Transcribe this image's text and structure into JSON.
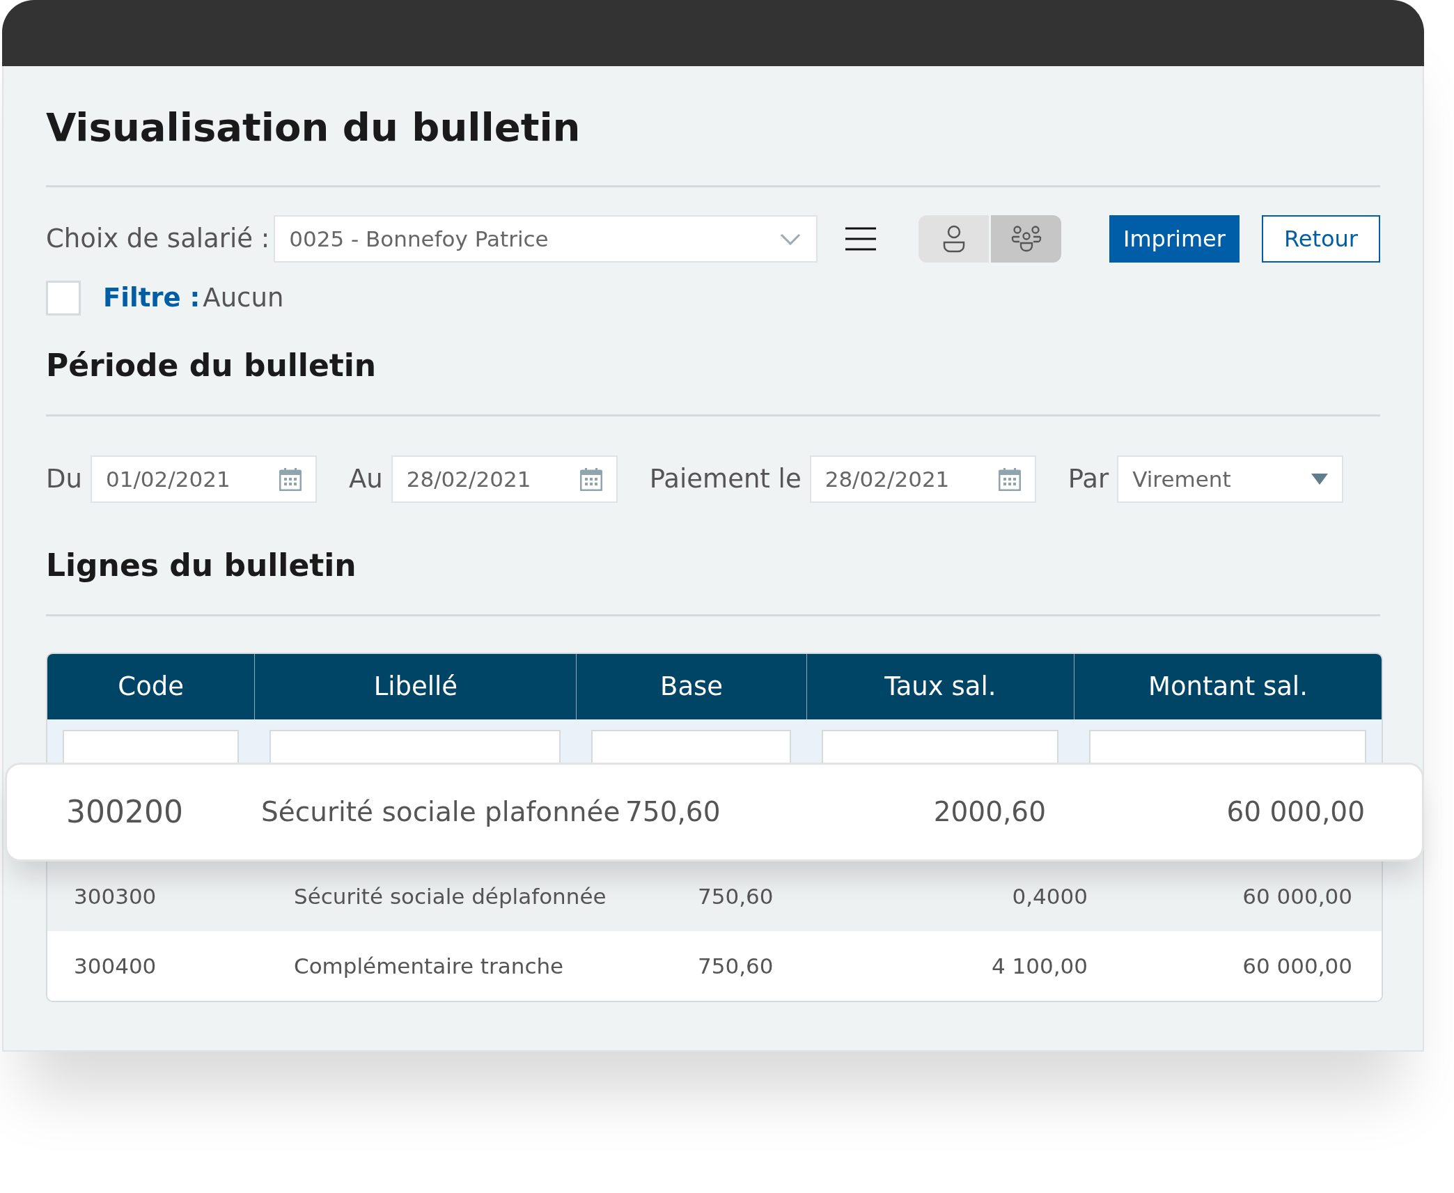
{
  "title": "Visualisation du bulletin",
  "employee_selector": {
    "label": "Choix de salarié :",
    "value": "0025 - Bonnefoy Patrice"
  },
  "view_toggle": [
    {
      "kind": "single",
      "selected": false
    },
    {
      "kind": "group",
      "selected": true
    }
  ],
  "buttons": [
    {
      "label": "Imprimer",
      "kind": "primary"
    },
    {
      "label": "Retour",
      "kind": "secondary"
    }
  ],
  "filter": {
    "checked": false,
    "label": "Filtre :",
    "value": "Aucun"
  },
  "period": {
    "heading": "Période du bulletin",
    "fields": [
      {
        "label": "Du",
        "value": "01/02/2021",
        "kind": "date"
      },
      {
        "label": "Au",
        "value": "28/02/2021",
        "kind": "date"
      },
      {
        "label": "Paiement le",
        "value": "28/02/2021",
        "kind": "date"
      },
      {
        "label": "Par",
        "value": "Virement",
        "kind": "select"
      }
    ]
  },
  "lines": {
    "heading": "Lignes du bulletin",
    "columns": [
      "Code",
      "Libellé",
      "Base",
      "Taux sal.",
      "Montant sal."
    ],
    "rows": [
      {
        "highlighted": true,
        "cells": [
          "300200",
          "Sécurité sociale plafonnée",
          "750,60",
          "2000,60",
          "60 000,00"
        ]
      },
      {
        "highlighted": false,
        "cells": [
          "300300",
          "Sécurité sociale  déplafonnée",
          "750,60",
          "0,4000",
          "60 000,00"
        ]
      },
      {
        "highlighted": false,
        "cells": [
          "300400",
          "Complémentaire tranche",
          "750,60",
          "4 100,00",
          "60 000,00"
        ]
      }
    ]
  }
}
